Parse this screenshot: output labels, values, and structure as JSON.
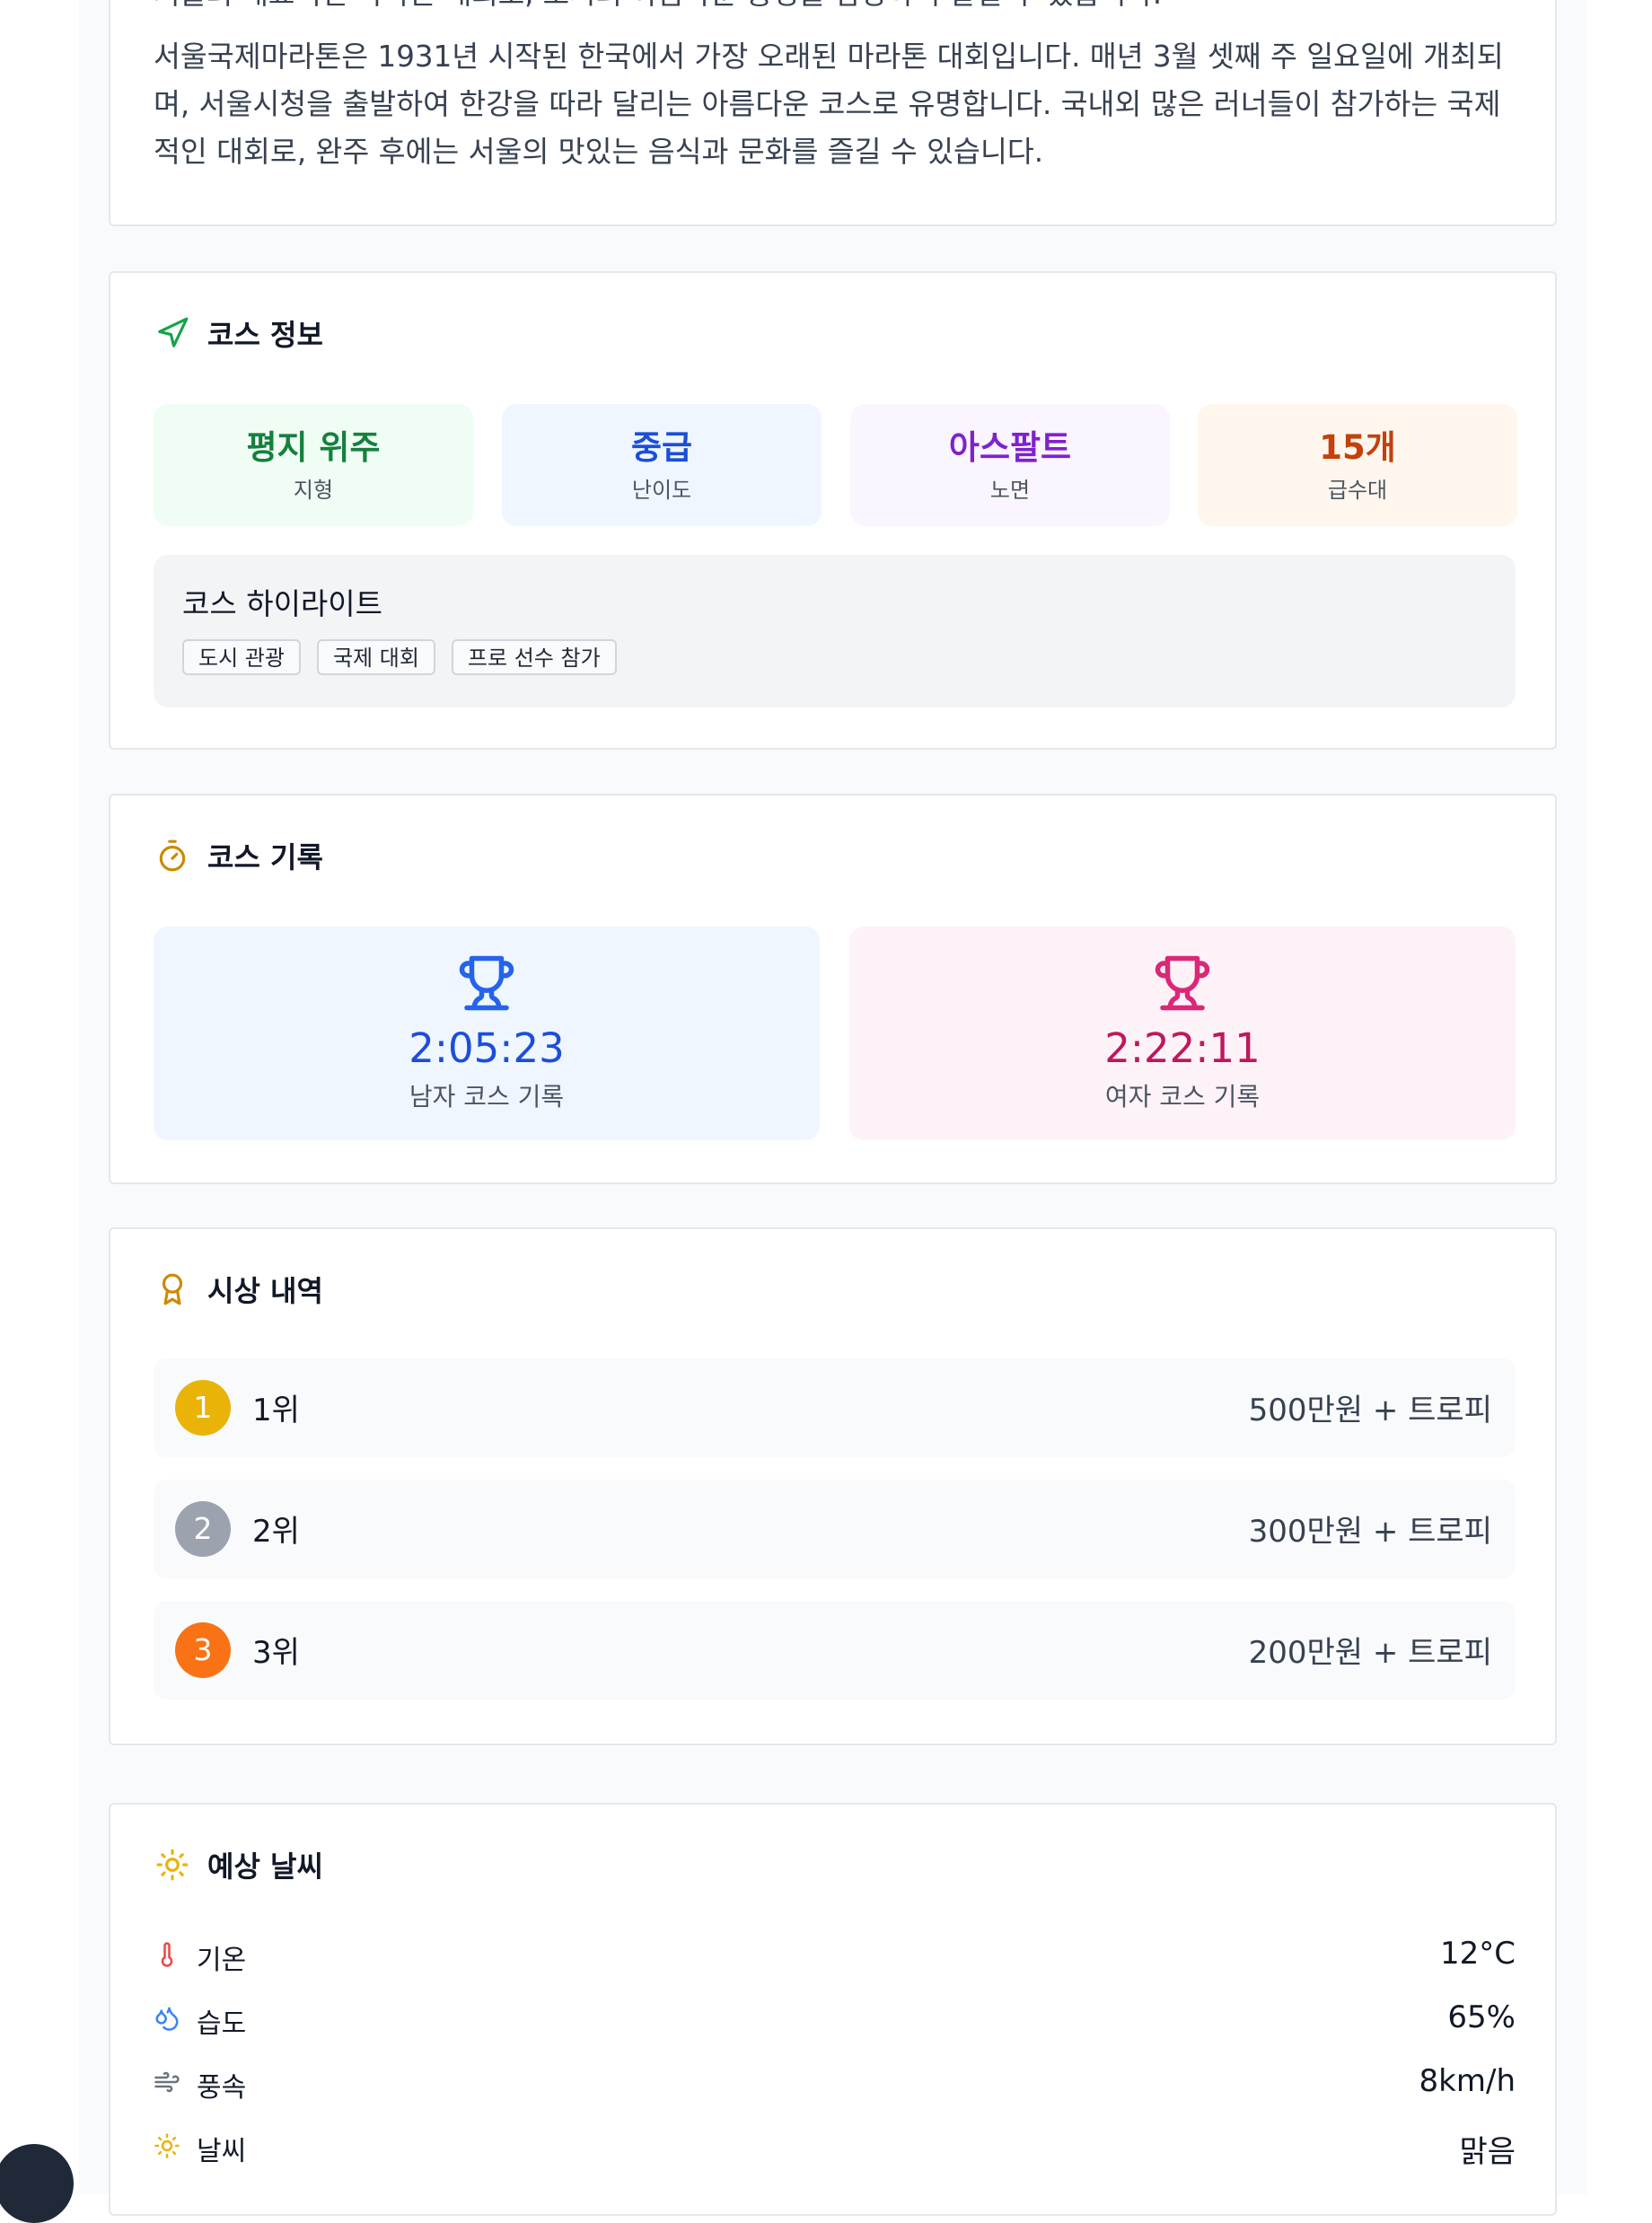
{
  "intro": {
    "cut_line": "서울의 대표적인 마라톤 대회로, 도시의 아름다운 풍경을 감상하며 달릴 수 있습니다.",
    "paragraph": "서울국제마라톤은 1931년 시작된 한국에서 가장 오래된 마라톤 대회입니다. 매년 3월 셋째 주 일요일에 개최되며, 서울시청을 출발하여 한강을 따라 달리는 아름다운 코스로 유명합니다. 국내외 많은 러너들이 참가하는 국제적인 대회로, 완주 후에는 서울의 맛있는 음식과 문화를 즐길 수 있습니다."
  },
  "course_info": {
    "title": "코스 정보",
    "icon": "navigation-icon",
    "stats": [
      {
        "value": "평지 위주",
        "label": "지형",
        "color": "#15803d",
        "bg": "#f0fdf4"
      },
      {
        "value": "중급",
        "label": "난이도",
        "color": "#1d4ed8",
        "bg": "#eff6ff"
      },
      {
        "value": "아스팔트",
        "label": "노면",
        "color": "#7e22ce",
        "bg": "#faf5ff"
      },
      {
        "value": "15개",
        "label": "급수대",
        "color": "#c2410c",
        "bg": "#fff7ed"
      }
    ],
    "highlights_title": "코스 하이라이트",
    "tags": [
      "도시 관광",
      "국제 대회",
      "프로 선수 참가"
    ]
  },
  "records": {
    "title": "코스 기록",
    "icon": "stopwatch-icon",
    "items": [
      {
        "time": "2:05:23",
        "label": "남자 코스 기록",
        "color": "#1d4ed8",
        "bg": "#eff6ff"
      },
      {
        "time": "2:22:11",
        "label": "여자 코스 기록",
        "color": "#be185d",
        "bg": "#fdf2f8"
      }
    ]
  },
  "prizes": {
    "title": "시상 내역",
    "icon": "award-icon",
    "items": [
      {
        "badge": "1",
        "rank": "1위",
        "amount": "500만원 + 트로피",
        "color": "#eab308"
      },
      {
        "badge": "2",
        "rank": "2위",
        "amount": "300만원 + 트로피",
        "color": "#9ca3af"
      },
      {
        "badge": "3",
        "rank": "3위",
        "amount": "200만원 + 트로피",
        "color": "#f97316"
      }
    ]
  },
  "weather": {
    "title": "예상 날씨",
    "icon": "sun-icon",
    "rows": [
      {
        "icon": "thermometer-icon",
        "label": "기온",
        "value": "12°C"
      },
      {
        "icon": "droplets-icon",
        "label": "습도",
        "value": "65%"
      },
      {
        "icon": "wind-icon",
        "label": "풍속",
        "value": "8km/h"
      },
      {
        "icon": "sun-icon",
        "label": "날씨",
        "value": "맑음"
      }
    ]
  }
}
